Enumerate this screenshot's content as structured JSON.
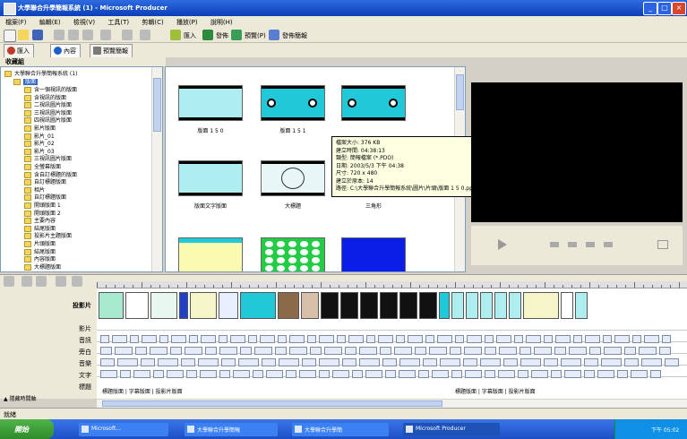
{
  "window": {
    "title": "大學聯合升學簡報系統 (1) - Microsoft Producer",
    "min": "_",
    "max": "□",
    "close": "×"
  },
  "menu": [
    "檔案(F)",
    "編輯(E)",
    "檢視(V)",
    "工具(T)",
    "剪輯(C)",
    "播放(P)",
    "說明(H)"
  ],
  "toolbar": {
    "import_label": "匯入",
    "publish_label": "發佈",
    "preview_label": "預覽(P)",
    "publish_pres_label": "發佈簡報"
  },
  "tabs": [
    {
      "label": "匯入",
      "icon": "import-icon",
      "color": "#c0392b"
    },
    {
      "label": "內容",
      "icon": "info-icon",
      "color": "#1f5fc8"
    },
    {
      "label": "預覽簡報",
      "icon": "preview-icon",
      "color": "#7a7a7a"
    }
  ],
  "collections_header": "收藏組",
  "tree": {
    "root": "大學聯合升學簡報系統 (1)",
    "selected": "版面",
    "items": [
      "含一個視訊的版面",
      "含視訊的版面",
      "二視訊圖片版面",
      "三視訊圖片版面",
      "四視訊圖片版面",
      "影片版面",
      "影片_01",
      "影片_02",
      "影片_03",
      "三視訊圖片版面",
      "全螢幕版面",
      "含自訂標題的版面",
      "自訂標題版面",
      "相片",
      "自訂標題版面",
      "開頭版面 1",
      "開頭版面 2",
      "主要內容",
      "結尾版面",
      "投影片主題版面",
      "片頭版面",
      "結尾版面",
      "內容版面",
      "大標題版面"
    ]
  },
  "thumbnails": [
    {
      "label": "版面 1 5 0",
      "bg": "#aeeef0",
      "style": "plain"
    },
    {
      "label": "版面 1 5 1",
      "bg": "#20c8d8",
      "style": "dots"
    },
    {
      "label": "",
      "bg": "#20c8d8",
      "style": "dots"
    },
    {
      "label": "版面文字版面",
      "bg": "#aeeef0",
      "style": "plain"
    },
    {
      "label": "大標題",
      "bg": "#e8f6f8",
      "style": "circle"
    },
    {
      "label": "三角形",
      "bg": "#ffffff",
      "style": "blank"
    },
    {
      "label": "",
      "bg": "#fafab0",
      "style": "yellow"
    },
    {
      "label": "",
      "bg": "#22cc44",
      "style": "grid"
    },
    {
      "label": "",
      "bg": "#0a1ee8",
      "style": "blue"
    }
  ],
  "tooltip": [
    "檔案大小: 376 KB",
    "建立時間: 04:38:13",
    "類型: 簡報檔案 (*.PDO)",
    "日期: 2003/5/3 下午 04:38",
    "尺寸: 720 x 480",
    "建立於原本: 14",
    "路徑: C:\\大學聯合升學簡報系統\\圖片\\片頭\\版面 1 5 0.ppg"
  ],
  "timeline": {
    "rows": [
      "投影片",
      "影片",
      "音訊",
      "旁白",
      "音樂",
      "文字",
      "標題"
    ],
    "row_values": [
      "",
      "",
      "",
      "",
      "",
      "",
      "標題版面 | 字幕版面 | 投影片版面"
    ],
    "bottom_text_1": "標題版面 | 字幕版面 | 投影片版面",
    "bottom_text_2": "標題版面 | 字幕版面 | 投影片版面"
  },
  "status": {
    "text": "就緒"
  },
  "taskbar": {
    "start": "開始",
    "tasks": [
      "Microsoft...",
      "大學聯合升學簡報",
      "大學聯合升學簡",
      "Microsoft Producer"
    ],
    "clock": "下午 05:02"
  }
}
